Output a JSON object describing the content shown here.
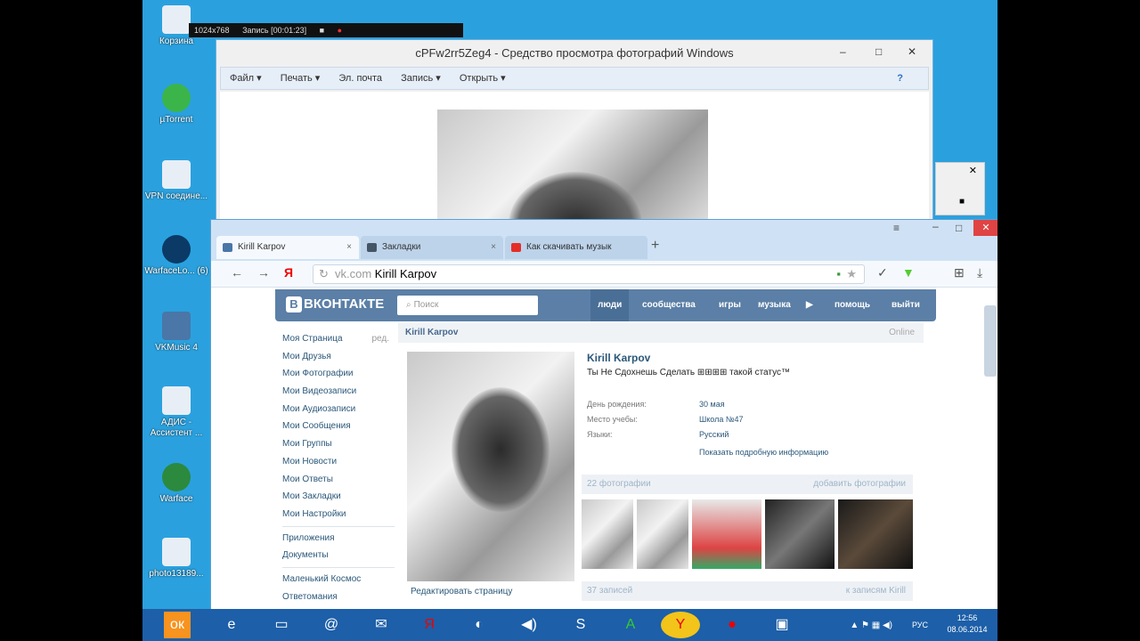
{
  "desktop": {
    "icons": [
      {
        "label": "Корзина"
      },
      {
        "label": "µTorrent"
      },
      {
        "label": "VPN соедине..."
      },
      {
        "label": "WarfaceLo... (6)"
      },
      {
        "label": "VKMusic 4"
      },
      {
        "label": "АДИС - Ассистент ..."
      },
      {
        "label": "Warface"
      },
      {
        "label": "photo13189..."
      }
    ]
  },
  "recorder": {
    "resolution": "1024x768",
    "record": "Запись [00:01:23]"
  },
  "viewer": {
    "title": "cPFw2rr5Zeg4 - Средство просмотра фотографий Windows",
    "menu": [
      "Файл ▾",
      "Печать ▾",
      "Эл. почта",
      "Запись ▾",
      "Открыть ▾"
    ],
    "help": "?"
  },
  "browser": {
    "tabs": [
      {
        "label": "Kirill Karpov",
        "close": "×"
      },
      {
        "label": "Закладки",
        "close": "×"
      },
      {
        "label": "Как скачивать музык",
        "close": "×"
      }
    ],
    "newtab": "+",
    "url_host": "vk.com",
    "url_title": "Kirill Karpov"
  },
  "vk": {
    "logo": "ВКОНТАКТЕ",
    "logo_letter": "В",
    "search_placeholder": "Поиск",
    "nav": [
      "люди",
      "сообщества",
      "игры",
      "музыка",
      "помощь",
      "выйти"
    ],
    "menu": [
      "Моя Страница",
      "Мои Друзья",
      "Мои Фотографии",
      "Мои Видеозаписи",
      "Мои Аудиозаписи",
      "Мои Сообщения",
      "Мои Группы",
      "Мои Новости",
      "Мои Ответы",
      "Мои Закладки",
      "Мои Настройки"
    ],
    "edit": "ред.",
    "menu2": [
      "Приложения",
      "Документы"
    ],
    "menu3": [
      "Маленький Космос",
      "Ответомания"
    ],
    "profile": {
      "header": "Kirill Karpov",
      "online": "Online",
      "name": "Kirill Karpov",
      "status": "Ты  Не  Сдохнешь     Сделать  ⊞⊞⊞⊞     такой статус™",
      "info": [
        {
          "k": "День рождения:",
          "v": "30 мая"
        },
        {
          "k": "Место учебы:",
          "v": "Школа №47"
        },
        {
          "k": "Языки:",
          "v": "Русский"
        }
      ],
      "more": "Показать подробную информацию",
      "photos_header": "22 фотографии",
      "photos_add": "добавить фотографии",
      "edit_page": "Редактировать страницу",
      "posts": "37 записей",
      "posts_link": "к записям Kirill"
    }
  },
  "taskbar": {
    "lang": "РУС",
    "time": "12:56",
    "date": "08.06.2014"
  }
}
